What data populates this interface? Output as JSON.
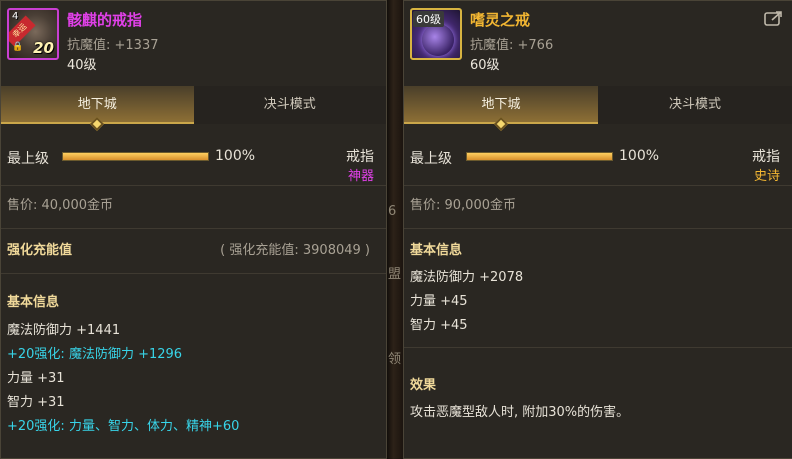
{
  "left": {
    "icon": {
      "ribbon": "幸运",
      "lock": "🔒",
      "level": "20",
      "num": "4"
    },
    "name": "骸麒的戒指",
    "name_color": "#e040e8",
    "stat": "抗魔值: +1337",
    "level": "40级",
    "tabs": {
      "active": "地下城",
      "inactive": "决斗模式"
    },
    "grade_label": "最上级",
    "grade_percent": "100%",
    "grade_fill": 100,
    "slot": "戒指",
    "rarity": "神器",
    "rarity_color": "#e040e8",
    "price": "售价: 40,000金币",
    "enhance_title": "强化充能值",
    "enhance_value": "( 强化充能值: 3908049 )",
    "basic_title": "基本信息",
    "lines": [
      {
        "text": "魔法防御力 +1441",
        "cyan": false
      },
      {
        "text": "+20强化: 魔法防御力 +1296",
        "cyan": true
      },
      {
        "text": "力量 +31",
        "cyan": false
      },
      {
        "text": "智力 +31",
        "cyan": false
      },
      {
        "text": "+20强化: 力量、智力、体力、精神+60",
        "cyan": true
      }
    ]
  },
  "right": {
    "icon": {
      "tag": "60级"
    },
    "name": "嗜灵之戒",
    "name_color": "#f2b632",
    "stat": "抗魔值: +766",
    "level": "60级",
    "tabs": {
      "active": "地下城",
      "inactive": "决斗模式"
    },
    "grade_label": "最上级",
    "grade_percent": "100%",
    "grade_fill": 100,
    "slot": "戒指",
    "rarity": "史诗",
    "rarity_color": "#f2b632",
    "price": "售价: 90,000金币",
    "basic_title": "基本信息",
    "lines": [
      {
        "text": "魔法防御力 +2078"
      },
      {
        "text": "力量 +45"
      },
      {
        "text": "智力 +45"
      }
    ],
    "effect_title": "效果",
    "effect_text": "攻击恶魔型敌人时, 附加30%的伤害。"
  },
  "gap_glyphs": [
    "6",
    "盟",
    "领"
  ],
  "icons": {
    "share": "share-icon"
  }
}
